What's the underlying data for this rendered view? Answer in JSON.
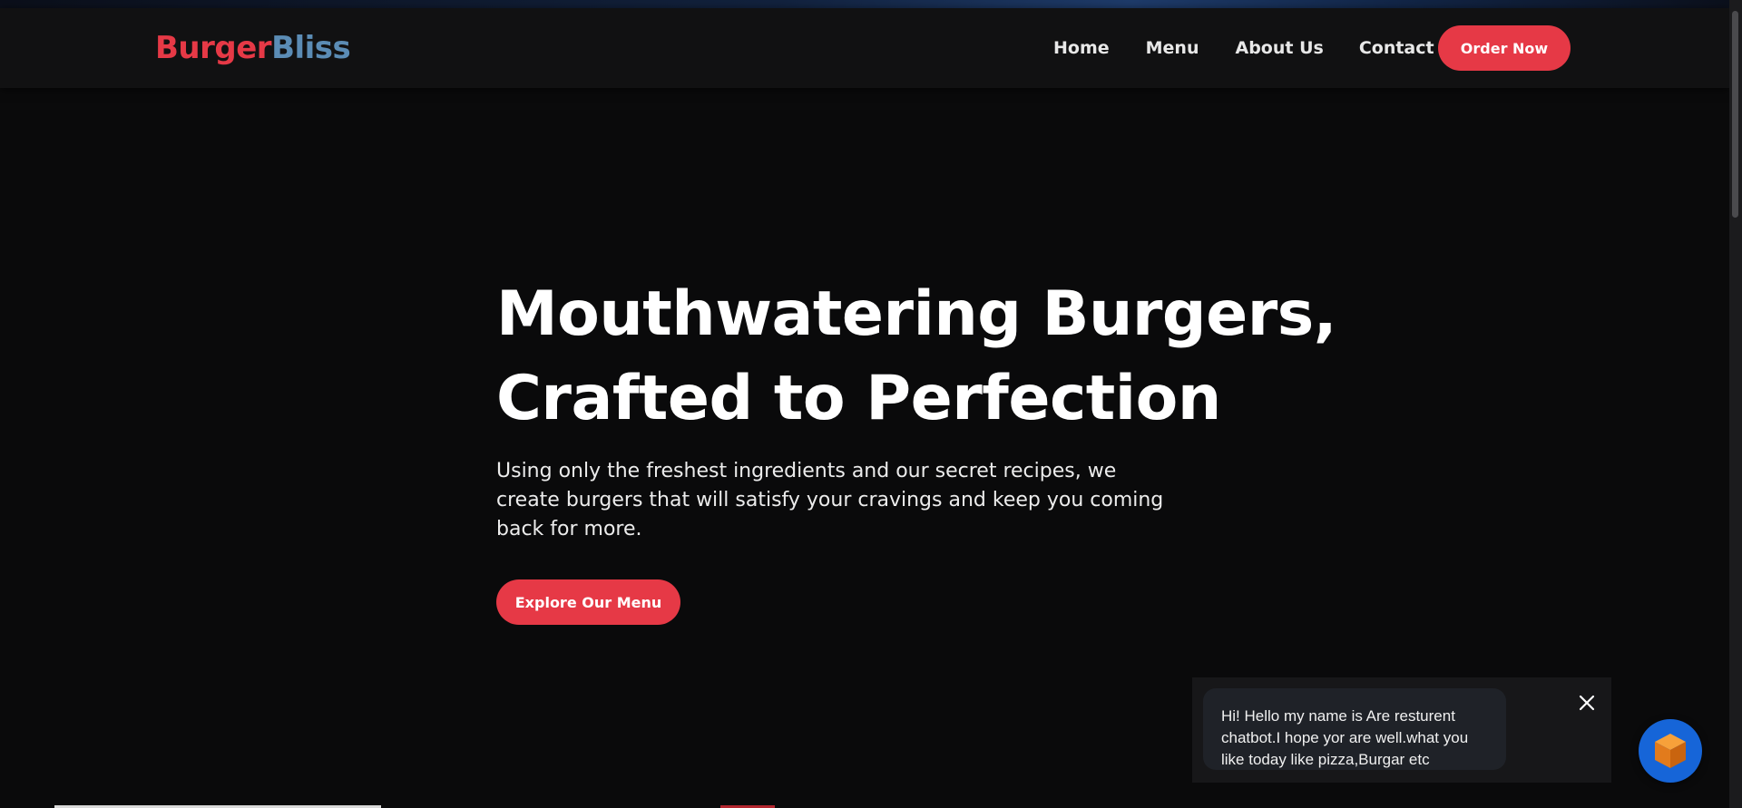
{
  "brand": {
    "name_part1": "Burger",
    "name_part2": "Bliss",
    "color_primary": "#e63946",
    "color_secondary": "#5b8cb5"
  },
  "nav": {
    "links": [
      "Home",
      "Menu",
      "About Us",
      "Contact"
    ],
    "cta_label": "Order Now"
  },
  "hero": {
    "title_line1": "Mouthwatering Burgers,",
    "title_line2": "Crafted to Perfection",
    "subtitle": "Using only the freshest ingredients and our secret recipes, we create burgers that will satisfy your cravings and keep you coming back for more.",
    "cta_label": "Explore Our Menu"
  },
  "chatbot": {
    "message": "Hi! Hello my name is Are resturent chatbot.I hope yor are well.what you like today like pizza,Burgar etc",
    "close_icon": "close-icon",
    "launcher_icon": "chatbot-cube-icon",
    "launcher_color": "#1665d8"
  },
  "colors": {
    "background": "#0a0a0b",
    "navbar": "#111112",
    "accent": "#e63946"
  }
}
